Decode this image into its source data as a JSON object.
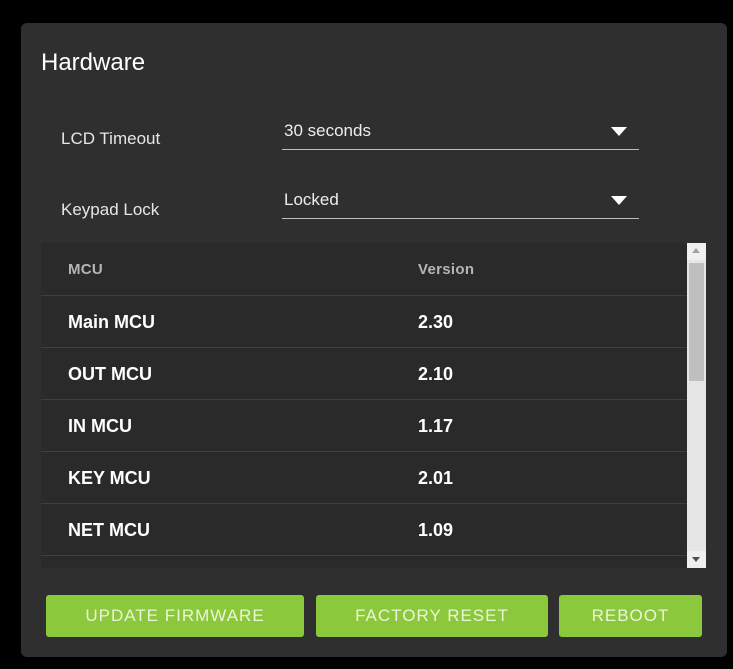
{
  "panel": {
    "title": "Hardware"
  },
  "settings": [
    {
      "label": "LCD Timeout",
      "value": "30 seconds"
    },
    {
      "label": "Keypad Lock",
      "value": "Locked"
    }
  ],
  "table": {
    "headers": {
      "mcu": "MCU",
      "version": "Version"
    },
    "rows": [
      {
        "mcu": "Main MCU",
        "version": "2.30"
      },
      {
        "mcu": "OUT MCU",
        "version": "2.10"
      },
      {
        "mcu": "IN MCU",
        "version": "1.17"
      },
      {
        "mcu": "KEY MCU",
        "version": "2.01"
      },
      {
        "mcu": "NET MCU",
        "version": "1.09"
      }
    ]
  },
  "buttons": {
    "update_firmware": "UPDATE FIRMWARE",
    "factory_reset": "FACTORY RESET",
    "reboot": "REBOOT"
  },
  "colors": {
    "accent": "#8cc83c",
    "panel": "#2f2f2f",
    "background": "#000000"
  },
  "icons": {
    "dropdown": "caret-down-icon",
    "scroll_up": "scroll-up-arrow-icon",
    "scroll_down": "scroll-down-arrow-icon"
  }
}
